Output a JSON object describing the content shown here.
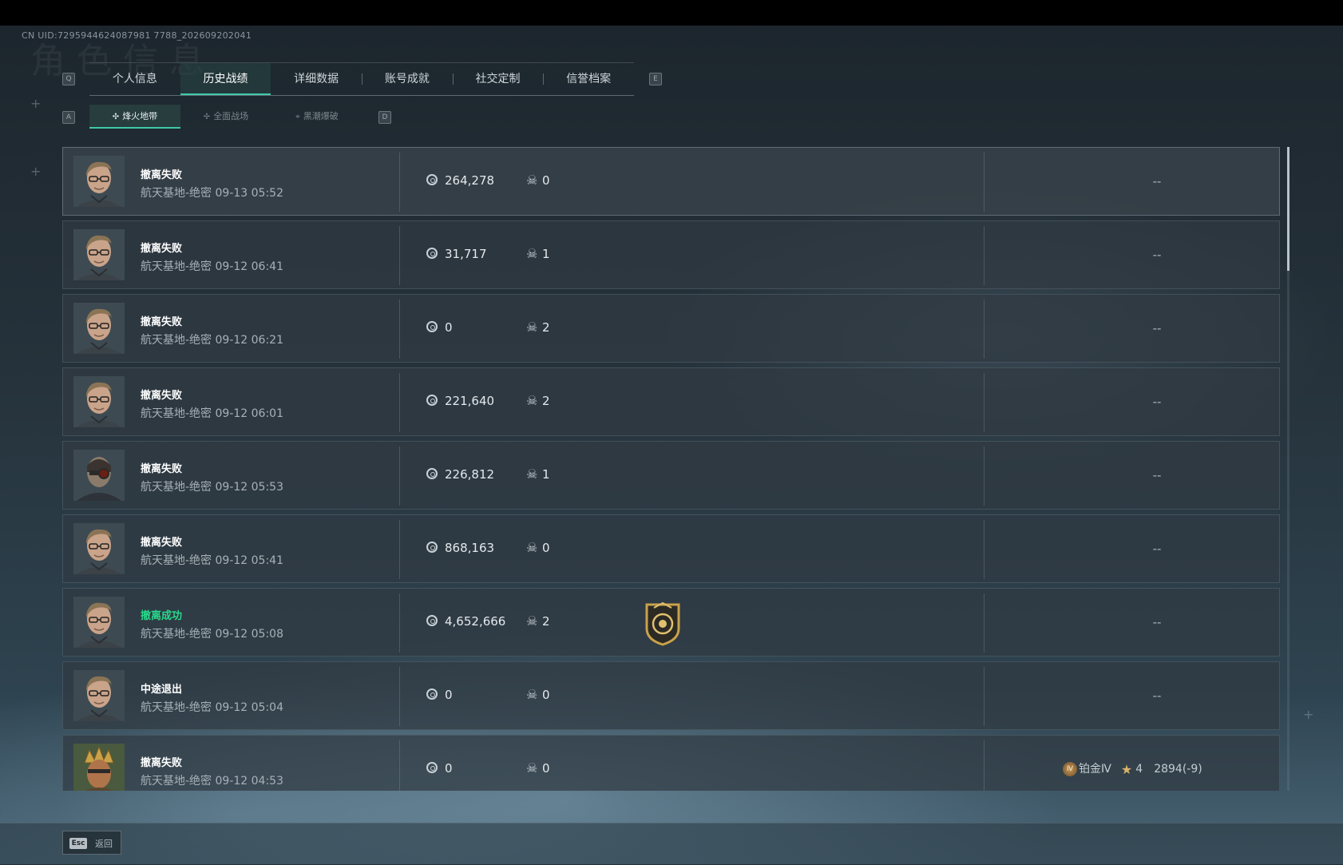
{
  "header": {
    "uid": "CN UID:7295944624087981 7788_202609202041",
    "ghost_title": "角色信息",
    "key_left": "Q",
    "key_right": "E",
    "sub_key_left": "A",
    "sub_key_right": "D"
  },
  "tabs": [
    {
      "label": "个人信息",
      "active": false
    },
    {
      "label": "历史战绩",
      "active": true
    },
    {
      "label": "详细数据",
      "active": false
    },
    {
      "label": "账号成就",
      "active": false
    },
    {
      "label": "社交定制",
      "active": false
    },
    {
      "label": "信誉档案",
      "active": false
    }
  ],
  "subtabs": [
    {
      "label": "烽火地带",
      "icon": "✣",
      "active": true
    },
    {
      "label": "全面战场",
      "icon": "✢",
      "active": false
    },
    {
      "label": "黑潮爆破",
      "icon": "⌖",
      "active": false
    }
  ],
  "matches": [
    {
      "status": "撤离失败",
      "success": false,
      "meta": "航天基地-绝密 09-13 05:52",
      "value": "264,278",
      "kills": "0",
      "rank": "--",
      "avatar": "soldier"
    },
    {
      "status": "撤离失败",
      "success": false,
      "meta": "航天基地-绝密 09-12 06:41",
      "value": "31,717",
      "kills": "1",
      "rank": "--",
      "avatar": "soldier"
    },
    {
      "status": "撤离失败",
      "success": false,
      "meta": "航天基地-绝密 09-12 06:21",
      "value": "0",
      "kills": "2",
      "rank": "--",
      "avatar": "soldier"
    },
    {
      "status": "撤离失败",
      "success": false,
      "meta": "航天基地-绝密 09-12 06:01",
      "value": "221,640",
      "kills": "2",
      "rank": "--",
      "avatar": "soldier"
    },
    {
      "status": "撤离失败",
      "success": false,
      "meta": "航天基地-绝密 09-12 05:53",
      "value": "226,812",
      "kills": "1",
      "rank": "--",
      "avatar": "masked"
    },
    {
      "status": "撤离失败",
      "success": false,
      "meta": "航天基地-绝密 09-12 05:41",
      "value": "868,163",
      "kills": "0",
      "rank": "--",
      "avatar": "soldier"
    },
    {
      "status": "撤离成功",
      "success": true,
      "meta": "航天基地-绝密 09-12 05:08",
      "value": "4,652,666",
      "kills": "2",
      "rank": "--",
      "avatar": "soldier",
      "badge": "shield-badge-icon"
    },
    {
      "status": "中途退出",
      "success": false,
      "meta": "航天基地-绝密 09-12 05:04",
      "value": "0",
      "kills": "0",
      "rank": "--",
      "avatar": "soldier"
    },
    {
      "status": "撤离失败",
      "success": false,
      "meta": "航天基地-绝密 09-12 04:53",
      "value": "0",
      "kills": "0",
      "rank": "",
      "avatar": "crowned",
      "rank_info": {
        "tier_icon": "Ⅳ",
        "tier": "铂金Ⅳ",
        "stars": "4",
        "score": "2894(-9)"
      }
    }
  ],
  "footer": {
    "esc_key": "Esc",
    "back_label": "返回"
  },
  "colors": {
    "accent": "#3fc9a6",
    "success": "#27d98a",
    "background": "#26333c"
  }
}
